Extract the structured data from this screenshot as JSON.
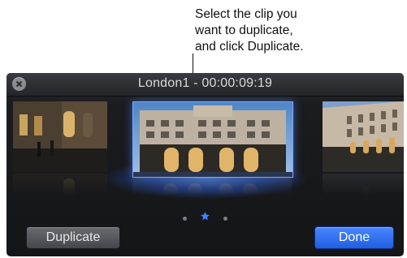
{
  "callout": {
    "lines": [
      "Select the clip you",
      "want to duplicate,",
      "and click Duplicate."
    ]
  },
  "window": {
    "title": "London1 - 00:00:09:19",
    "close_icon": "close-icon"
  },
  "clips": [
    {
      "name": "left-clip",
      "selected": false
    },
    {
      "name": "center-clip",
      "selected": true
    },
    {
      "name": "right-clip",
      "selected": false
    }
  ],
  "pager": {
    "count": 3,
    "active_index": 1
  },
  "buttons": {
    "duplicate_label": "Duplicate",
    "done_label": "Done"
  },
  "colors": {
    "accent": "#2f6bf0",
    "glow": "#5a96ff",
    "panel": "#1b1c1f"
  }
}
